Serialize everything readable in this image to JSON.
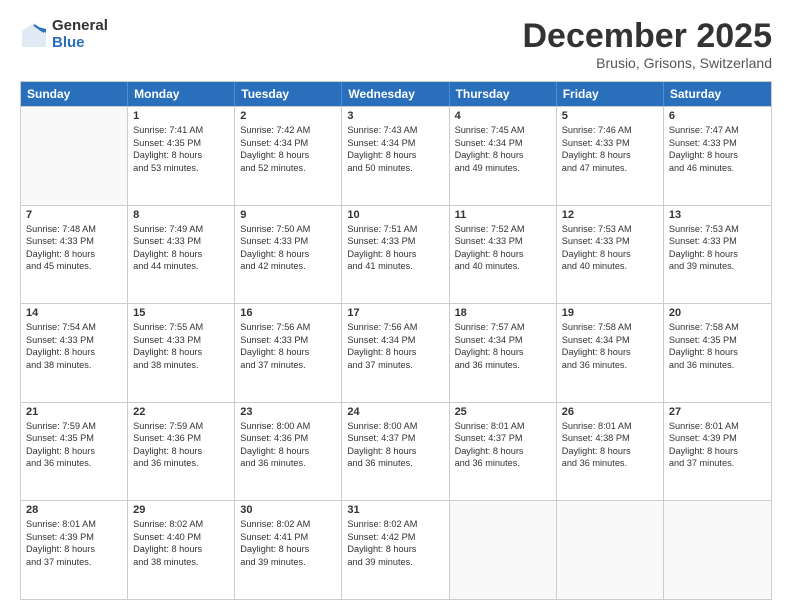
{
  "logo": {
    "general": "General",
    "blue": "Blue"
  },
  "title": "December 2025",
  "subtitle": "Brusio, Grisons, Switzerland",
  "days": [
    "Sunday",
    "Monday",
    "Tuesday",
    "Wednesday",
    "Thursday",
    "Friday",
    "Saturday"
  ],
  "weeks": [
    [
      {
        "day": "",
        "empty": true
      },
      {
        "day": "1",
        "sunrise": "7:41 AM",
        "sunset": "4:35 PM",
        "daylight": "8 hours and 53 minutes."
      },
      {
        "day": "2",
        "sunrise": "7:42 AM",
        "sunset": "4:34 PM",
        "daylight": "8 hours and 52 minutes."
      },
      {
        "day": "3",
        "sunrise": "7:43 AM",
        "sunset": "4:34 PM",
        "daylight": "8 hours and 50 minutes."
      },
      {
        "day": "4",
        "sunrise": "7:45 AM",
        "sunset": "4:34 PM",
        "daylight": "8 hours and 49 minutes."
      },
      {
        "day": "5",
        "sunrise": "7:46 AM",
        "sunset": "4:33 PM",
        "daylight": "8 hours and 47 minutes."
      },
      {
        "day": "6",
        "sunrise": "7:47 AM",
        "sunset": "4:33 PM",
        "daylight": "8 hours and 46 minutes."
      }
    ],
    [
      {
        "day": "7",
        "sunrise": "7:48 AM",
        "sunset": "4:33 PM",
        "daylight": "8 hours and 45 minutes."
      },
      {
        "day": "8",
        "sunrise": "7:49 AM",
        "sunset": "4:33 PM",
        "daylight": "8 hours and 44 minutes."
      },
      {
        "day": "9",
        "sunrise": "7:50 AM",
        "sunset": "4:33 PM",
        "daylight": "8 hours and 42 minutes."
      },
      {
        "day": "10",
        "sunrise": "7:51 AM",
        "sunset": "4:33 PM",
        "daylight": "8 hours and 41 minutes."
      },
      {
        "day": "11",
        "sunrise": "7:52 AM",
        "sunset": "4:33 PM",
        "daylight": "8 hours and 40 minutes."
      },
      {
        "day": "12",
        "sunrise": "7:53 AM",
        "sunset": "4:33 PM",
        "daylight": "8 hours and 40 minutes."
      },
      {
        "day": "13",
        "sunrise": "7:53 AM",
        "sunset": "4:33 PM",
        "daylight": "8 hours and 39 minutes."
      }
    ],
    [
      {
        "day": "14",
        "sunrise": "7:54 AM",
        "sunset": "4:33 PM",
        "daylight": "8 hours and 38 minutes."
      },
      {
        "day": "15",
        "sunrise": "7:55 AM",
        "sunset": "4:33 PM",
        "daylight": "8 hours and 38 minutes."
      },
      {
        "day": "16",
        "sunrise": "7:56 AM",
        "sunset": "4:33 PM",
        "daylight": "8 hours and 37 minutes."
      },
      {
        "day": "17",
        "sunrise": "7:56 AM",
        "sunset": "4:34 PM",
        "daylight": "8 hours and 37 minutes."
      },
      {
        "day": "18",
        "sunrise": "7:57 AM",
        "sunset": "4:34 PM",
        "daylight": "8 hours and 36 minutes."
      },
      {
        "day": "19",
        "sunrise": "7:58 AM",
        "sunset": "4:34 PM",
        "daylight": "8 hours and 36 minutes."
      },
      {
        "day": "20",
        "sunrise": "7:58 AM",
        "sunset": "4:35 PM",
        "daylight": "8 hours and 36 minutes."
      }
    ],
    [
      {
        "day": "21",
        "sunrise": "7:59 AM",
        "sunset": "4:35 PM",
        "daylight": "8 hours and 36 minutes."
      },
      {
        "day": "22",
        "sunrise": "7:59 AM",
        "sunset": "4:36 PM",
        "daylight": "8 hours and 36 minutes."
      },
      {
        "day": "23",
        "sunrise": "8:00 AM",
        "sunset": "4:36 PM",
        "daylight": "8 hours and 36 minutes."
      },
      {
        "day": "24",
        "sunrise": "8:00 AM",
        "sunset": "4:37 PM",
        "daylight": "8 hours and 36 minutes."
      },
      {
        "day": "25",
        "sunrise": "8:01 AM",
        "sunset": "4:37 PM",
        "daylight": "8 hours and 36 minutes."
      },
      {
        "day": "26",
        "sunrise": "8:01 AM",
        "sunset": "4:38 PM",
        "daylight": "8 hours and 36 minutes."
      },
      {
        "day": "27",
        "sunrise": "8:01 AM",
        "sunset": "4:39 PM",
        "daylight": "8 hours and 37 minutes."
      }
    ],
    [
      {
        "day": "28",
        "sunrise": "8:01 AM",
        "sunset": "4:39 PM",
        "daylight": "8 hours and 37 minutes."
      },
      {
        "day": "29",
        "sunrise": "8:02 AM",
        "sunset": "4:40 PM",
        "daylight": "8 hours and 38 minutes."
      },
      {
        "day": "30",
        "sunrise": "8:02 AM",
        "sunset": "4:41 PM",
        "daylight": "8 hours and 39 minutes."
      },
      {
        "day": "31",
        "sunrise": "8:02 AM",
        "sunset": "4:42 PM",
        "daylight": "8 hours and 39 minutes."
      },
      {
        "day": "",
        "empty": true
      },
      {
        "day": "",
        "empty": true
      },
      {
        "day": "",
        "empty": true
      }
    ]
  ]
}
